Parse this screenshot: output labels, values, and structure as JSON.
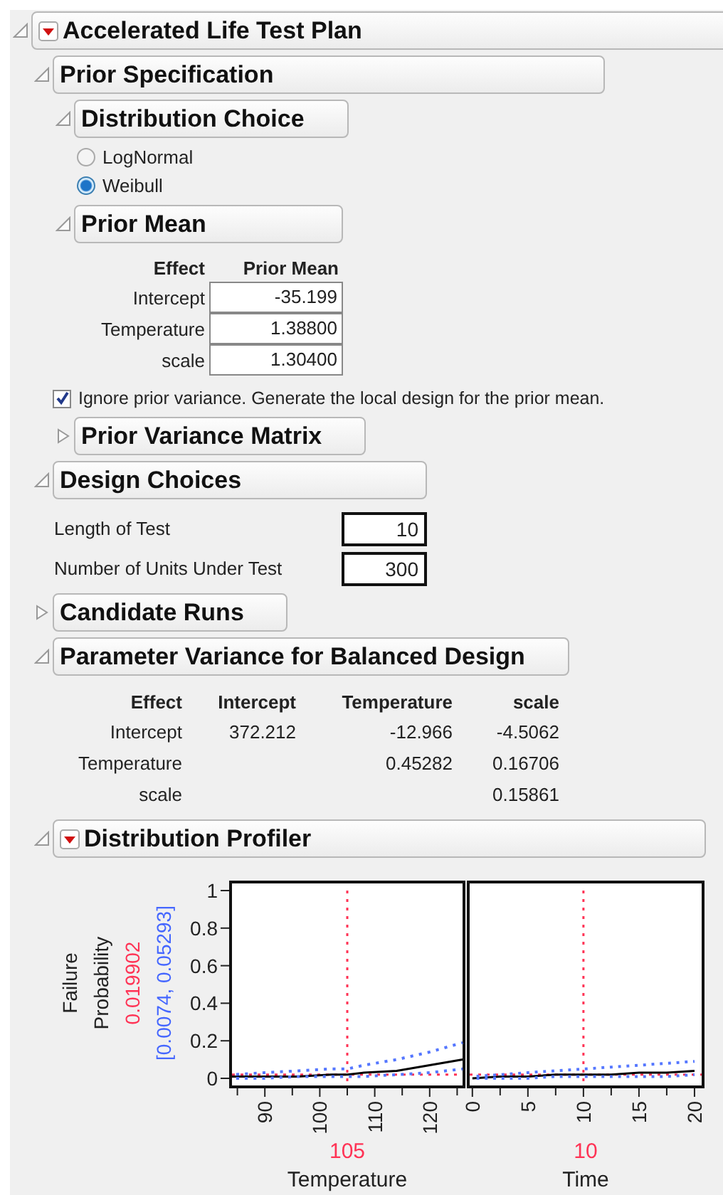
{
  "report": {
    "kind": "node",
    "title": "Accelerated Life Test Plan",
    "expanded": true,
    "menu": true,
    "children": [
      {
        "kind": "node",
        "title": "Prior Specification",
        "expanded": true,
        "menu": false,
        "children": [
          {
            "kind": "node",
            "title": "Distribution Choice",
            "expanded": true,
            "menu": false,
            "children": [
              {
                "kind": "radios",
                "options": [
                  {
                    "label": "LogNormal",
                    "selected": false
                  },
                  {
                    "label": "Weibull",
                    "selected": true
                  }
                ]
              }
            ]
          },
          {
            "kind": "node",
            "title": "Prior Mean",
            "expanded": true,
            "menu": false,
            "children": [
              {
                "kind": "entry_table",
                "columns": [
                  "Effect",
                  "Prior Mean"
                ],
                "rows": [
                  {
                    "effect": "Intercept",
                    "value": "-35.199"
                  },
                  {
                    "effect": "Temperature",
                    "value": "1.38800"
                  },
                  {
                    "effect": "scale",
                    "value": "1.30400"
                  }
                ]
              }
            ]
          },
          {
            "kind": "checkbox",
            "label": "Ignore prior variance. Generate the local design for the prior mean.",
            "checked": true
          },
          {
            "kind": "node",
            "title": "Prior Variance Matrix",
            "expanded": false,
            "menu": false
          }
        ]
      },
      {
        "kind": "node",
        "title": "Design Choices",
        "expanded": true,
        "menu": false,
        "children": [
          {
            "kind": "fields",
            "items": [
              {
                "label": "Length of Test",
                "value": "10"
              },
              {
                "label": "Number of Units Under Test",
                "value": "300"
              }
            ]
          }
        ]
      },
      {
        "kind": "node",
        "title": "Candidate Runs",
        "expanded": false,
        "menu": false
      },
      {
        "kind": "node",
        "title": "Parameter Variance for Balanced Design",
        "expanded": true,
        "menu": false,
        "children": [
          {
            "kind": "matrix",
            "columns": [
              "Effect",
              "Intercept",
              "Temperature",
              "scale"
            ],
            "rows": [
              {
                "effect": "Intercept",
                "values": [
                  "372.212",
                  "-12.966",
                  "-4.5062"
                ]
              },
              {
                "effect": "Temperature",
                "values": [
                  "0.45282",
                  "0.16706"
                ]
              },
              {
                "effect": "scale",
                "values": [
                  "0.15861"
                ]
              }
            ]
          }
        ]
      },
      {
        "kind": "node",
        "title": "Distribution Profiler",
        "expanded": true,
        "menu": true,
        "children": [
          {
            "kind": "profiler",
            "y_label": "Failure Probability",
            "current_value": "0.019902",
            "interval": "[0.0074, 0.05293]",
            "panels": [
              {
                "factor": "Temperature",
                "value": "105",
                "chart_data": {
                  "type": "line",
                  "x": [
                    84,
                    90,
                    96,
                    102,
                    105,
                    108,
                    114,
                    120,
                    126
                  ],
                  "series": [
                    {
                      "color": "#000000",
                      "line_style": "solid",
                      "values": [
                        0.01,
                        0.01,
                        0.01,
                        0.02,
                        0.02,
                        0.03,
                        0.04,
                        0.07,
                        0.1
                      ]
                    },
                    {
                      "color": "#5577ff",
                      "line_style": "dotted",
                      "values": [
                        0,
                        0,
                        0.01,
                        0.01,
                        0.01,
                        0.01,
                        0.02,
                        0.03,
                        0.05
                      ]
                    },
                    {
                      "color": "#5577ff",
                      "line_style": "dotted",
                      "values": [
                        0.02,
                        0.03,
                        0.04,
                        0.05,
                        0.05,
                        0.07,
                        0.1,
                        0.14,
                        0.19
                      ]
                    }
                  ],
                  "xlim": [
                    83.5,
                    126.5
                  ],
                  "ylim": [
                    -0.053,
                    1.053
                  ],
                  "xticks": [
                    90,
                    100,
                    110,
                    120
                  ],
                  "yticks": [
                    0,
                    0.2,
                    0.4,
                    0.6,
                    0.8,
                    1
                  ],
                  "ref_lines": [
                    {
                      "axis": "x",
                      "value": 105,
                      "color": "#ff3355"
                    },
                    {
                      "axis": "y",
                      "value": 0.02,
                      "color": "#ff3355"
                    }
                  ]
                }
              },
              {
                "factor": "Time",
                "value": "10",
                "chart_data": {
                  "type": "line",
                  "x": [
                    0,
                    2.5,
                    5,
                    7.5,
                    10,
                    12.5,
                    15,
                    17.5,
                    20
                  ],
                  "series": [
                    {
                      "color": "#000000",
                      "line_style": "solid",
                      "values": [
                        0,
                        0.01,
                        0.01,
                        0.02,
                        0.02,
                        0.02,
                        0.03,
                        0.03,
                        0.04
                      ]
                    },
                    {
                      "color": "#5577ff",
                      "line_style": "dotted",
                      "values": [
                        0,
                        0,
                        0,
                        0.01,
                        0.01,
                        0.01,
                        0.01,
                        0.01,
                        0.02
                      ]
                    },
                    {
                      "color": "#5577ff",
                      "line_style": "dotted",
                      "values": [
                        0.01,
                        0.02,
                        0.03,
                        0.04,
                        0.05,
                        0.06,
                        0.07,
                        0.08,
                        0.09
                      ]
                    }
                  ],
                  "xlim": [
                    -0.5,
                    20.9
                  ],
                  "ylim": [
                    -0.053,
                    1.053
                  ],
                  "xticks": [
                    0,
                    5,
                    10,
                    15,
                    20
                  ],
                  "ref_lines": [
                    {
                      "axis": "x",
                      "value": 10,
                      "color": "#ff3355"
                    },
                    {
                      "axis": "y",
                      "value": 0.02,
                      "color": "#ff3355"
                    }
                  ]
                }
              }
            ]
          }
        ]
      }
    ]
  }
}
